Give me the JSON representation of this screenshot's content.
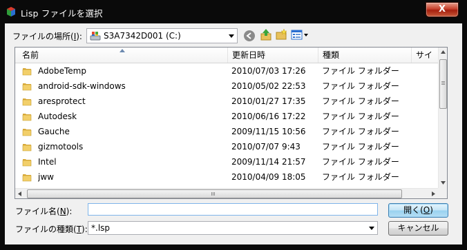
{
  "window": {
    "title": "Lisp ファイルを選択",
    "close_label": "X"
  },
  "look_in": {
    "label": "ファイルの場所(I):",
    "label_pre": "ファイルの場所(",
    "label_key": "I",
    "label_post": "):",
    "value": "S3A7342D001 (C:)"
  },
  "toolbar": {
    "back_icon": "back-arrow-icon",
    "up_icon": "up-folder-icon",
    "new_folder_icon": "new-folder-icon",
    "view_icon": "view-menu-icon"
  },
  "columns": [
    "名前",
    "更新日時",
    "種類",
    "サイ"
  ],
  "files": [
    {
      "name": "AdobeTemp",
      "date": "2010/07/03 17:26",
      "type": "ファイル フォルダー"
    },
    {
      "name": "android-sdk-windows",
      "date": "2010/05/02 22:53",
      "type": "ファイル フォルダー"
    },
    {
      "name": "aresprotect",
      "date": "2010/01/27 17:35",
      "type": "ファイル フォルダー"
    },
    {
      "name": "Autodesk",
      "date": "2010/06/16 17:22",
      "type": "ファイル フォルダー"
    },
    {
      "name": "Gauche",
      "date": "2009/11/15 10:56",
      "type": "ファイル フォルダー"
    },
    {
      "name": "gizmotools",
      "date": "2010/07/07 9:43",
      "type": "ファイル フォルダー"
    },
    {
      "name": "Intel",
      "date": "2009/11/14 21:57",
      "type": "ファイル フォルダー"
    },
    {
      "name": "jww",
      "date": "2010/04/09 18:05",
      "type": "ファイル フォルダー"
    }
  ],
  "filename": {
    "label_pre": "ファイル名(",
    "label_key": "N",
    "label_post": "):",
    "value": ""
  },
  "filetype": {
    "label_pre": "ファイルの種類(",
    "label_key": "T",
    "label_post": "):",
    "value": "*.lsp"
  },
  "buttons": {
    "open_pre": "開く(",
    "open_key": "O",
    "open_post": ")",
    "cancel": "キャンセル"
  },
  "colors": {
    "folder": "#e8c15a",
    "accent": "#3c7fb1",
    "close": "#c7402c"
  }
}
